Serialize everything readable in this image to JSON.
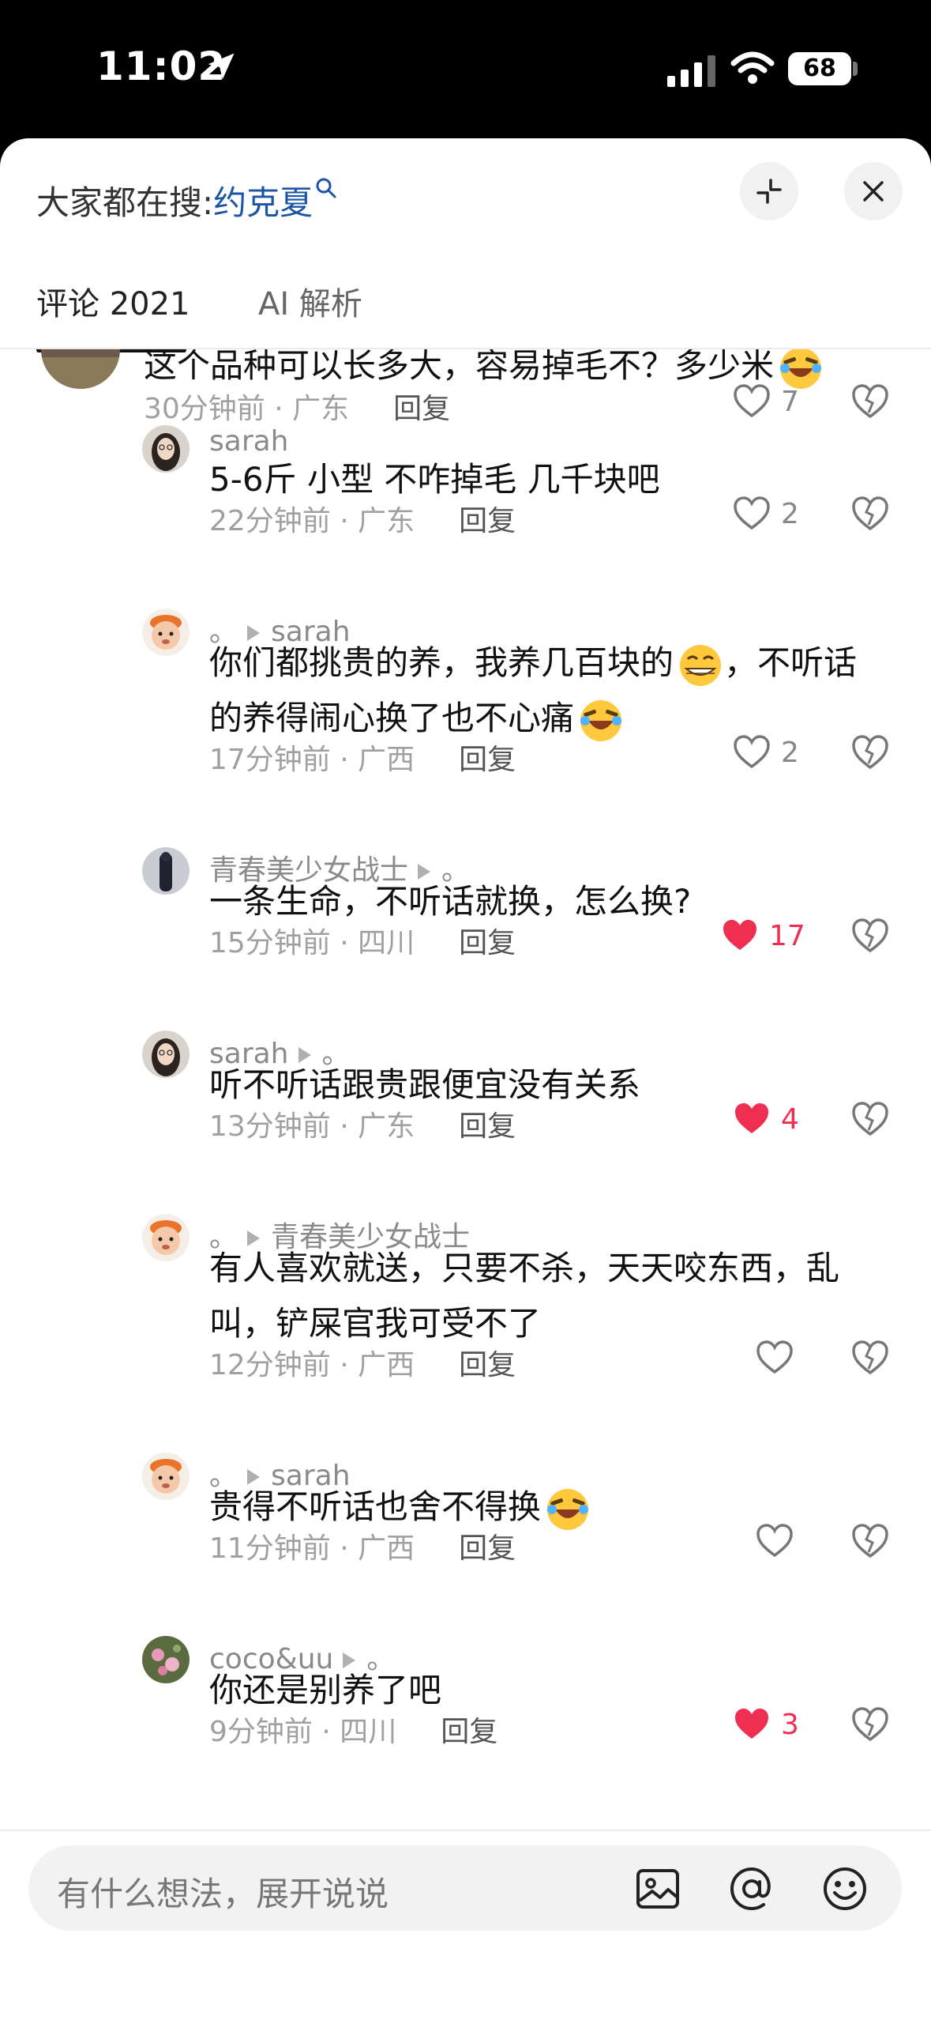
{
  "status_bar": {
    "time": "11:02",
    "battery": "68"
  },
  "header": {
    "search_prefix": "大家都在搜:",
    "search_keyword": "约克夏"
  },
  "tabs": [
    {
      "label": "评论 2021",
      "active": true
    },
    {
      "label": "AI 解析",
      "active": false
    }
  ],
  "colors": {
    "like_red": "#ef2f52",
    "link_blue": "#1d55a6"
  },
  "comments": {
    "top": {
      "text": "这个品种可以长多大，容易掉毛不？多少米",
      "emoji": "crying-laughing-emoji",
      "time": "30分钟前 · 广东",
      "reply_label": "回复",
      "likes": "7",
      "liked": false
    },
    "replies": [
      {
        "user": "sarah",
        "reply_to": "",
        "text_lines": [
          "5-6斤 小型 不咋掉毛 几千块吧"
        ],
        "time": "22分钟前 · 广东",
        "reply_label": "回复",
        "likes": "2",
        "liked": false,
        "avatar": "sarah-avatar"
      },
      {
        "user": "。",
        "reply_to": "sarah",
        "text_lines": [
          "你们都挑贵的养，我养几百块的",
          "的养得闹心换了也不心痛"
        ],
        "line1_tail": "，不听话",
        "time": "17分钟前 · 广西",
        "reply_label": "回复",
        "likes": "2",
        "liked": false,
        "avatar": "cartoon-kid-avatar"
      },
      {
        "user": "青春美少女战士",
        "reply_to": "。",
        "text_lines": [
          "一条生命，不听话就换，怎么换?"
        ],
        "time": "15分钟前 · 四川",
        "reply_label": "回复",
        "likes": "17",
        "liked": true,
        "avatar": "dark-figure-avatar"
      },
      {
        "user": "sarah",
        "reply_to": "。",
        "text_lines": [
          "听不听话跟贵跟便宜没有关系"
        ],
        "time": "13分钟前 · 广东",
        "reply_label": "回复",
        "likes": "4",
        "liked": true,
        "avatar": "sarah-avatar"
      },
      {
        "user": "。",
        "reply_to": "青春美少女战士",
        "text_lines": [
          "有人喜欢就送，只要不杀，天天咬东西，乱",
          "叫，铲屎官我可受不了"
        ],
        "time": "12分钟前 · 广西",
        "reply_label": "回复",
        "likes": "",
        "liked": false,
        "avatar": "cartoon-kid-avatar"
      },
      {
        "user": "。",
        "reply_to": "sarah",
        "text_lines": [
          "贵得不听话也舍不得换"
        ],
        "time": "11分钟前 · 广西",
        "reply_label": "回复",
        "likes": "",
        "liked": false,
        "avatar": "cartoon-kid-avatar"
      },
      {
        "user": "coco&uu",
        "reply_to": "。",
        "text_lines": [
          "你还是别养了吧"
        ],
        "time": "9分钟前 · 四川",
        "reply_label": "回复",
        "likes": "3",
        "liked": true,
        "avatar": "flower-avatar"
      }
    ]
  },
  "input": {
    "placeholder": "有什么想法，展开说说"
  }
}
